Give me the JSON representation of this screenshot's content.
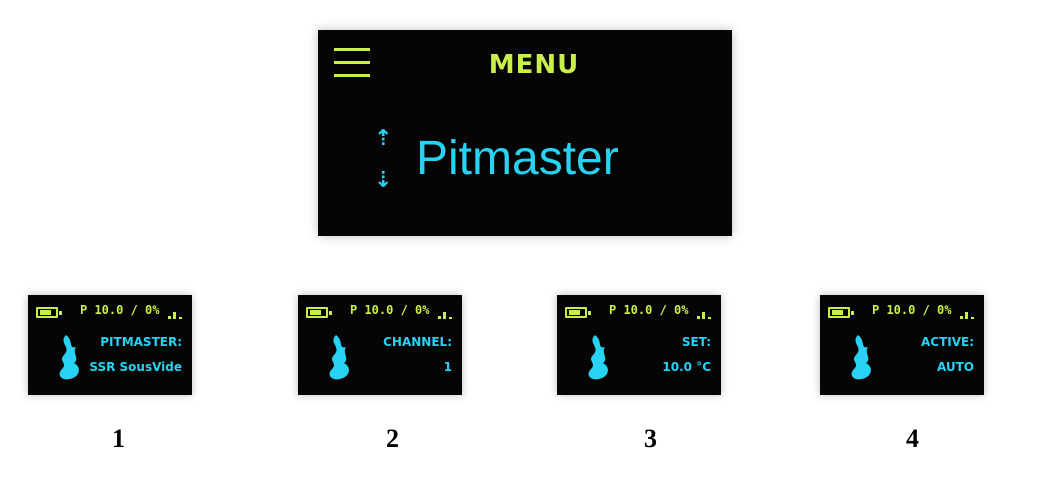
{
  "menu_screen": {
    "title": "MENU",
    "item": "Pitmaster",
    "up_arrow": "⇡",
    "down_arrow": "⇣"
  },
  "status_bar": {
    "text": "P 10.0 / 0%"
  },
  "screens": [
    {
      "number": "1",
      "label": "PITMASTER:",
      "value": "SSR SousVide"
    },
    {
      "number": "2",
      "label": "CHANNEL:",
      "value": "1"
    },
    {
      "number": "3",
      "label": "SET:",
      "value": "10.0 °C"
    },
    {
      "number": "4",
      "label": "ACTIVE:",
      "value": "AUTO"
    }
  ],
  "colors": {
    "accent_yellow": "#c9f04a",
    "accent_cyan": "#27d2f2",
    "screen_bg": "#050505"
  },
  "icons": [
    "hamburger-icon",
    "battery-icon",
    "signal-icon",
    "flame-icon",
    "up-arrow-icon",
    "down-arrow-icon"
  ]
}
